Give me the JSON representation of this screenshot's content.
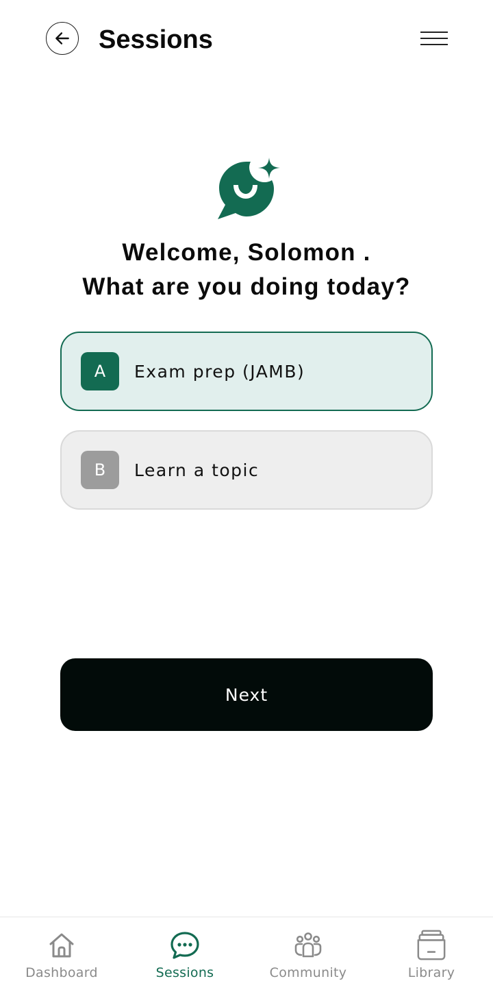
{
  "header": {
    "title": "Sessions",
    "back_icon": "arrow-left-icon",
    "menu_icon": "hamburger-menu-icon"
  },
  "logo": {
    "icon": "smiling-chat-sparkle-icon",
    "color": "#136b52"
  },
  "greeting": {
    "line1": "Welcome, Solomon .",
    "line2": "What are you doing today?"
  },
  "options": [
    {
      "letter": "A",
      "label": "Exam prep (JAMB)",
      "selected": true
    },
    {
      "letter": "B",
      "label": "Learn a topic",
      "selected": false
    }
  ],
  "next_button": {
    "label": "Next"
  },
  "bottom_nav": {
    "items": [
      {
        "label": "Dashboard",
        "icon": "home-icon",
        "active": false
      },
      {
        "label": "Sessions",
        "icon": "chat-bubble-icon",
        "active": true
      },
      {
        "label": "Community",
        "icon": "people-group-icon",
        "active": false
      },
      {
        "label": "Library",
        "icon": "archive-box-icon",
        "active": false
      }
    ]
  },
  "colors": {
    "accent": "#136b52",
    "selected_bg": "#e1efed",
    "unselected_bg": "#eeeeee",
    "button_bg": "#020b09",
    "inactive_nav": "#8a8a8a"
  }
}
